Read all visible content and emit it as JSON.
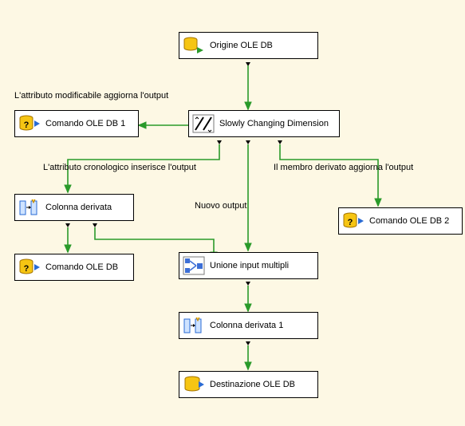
{
  "diagram": {
    "type": "ssis-data-flow",
    "background_color": "#fdf8e4",
    "nodes": {
      "source": {
        "label": "Origine OLE DB",
        "kind": "ole-db-source"
      },
      "scd": {
        "label": "Slowly Changing Dimension",
        "kind": "scd-transform"
      },
      "cmd1": {
        "label": "Comando OLE DB 1",
        "kind": "ole-db-command"
      },
      "cmd2": {
        "label": "Comando OLE DB 2",
        "kind": "ole-db-command"
      },
      "derived": {
        "label": "Colonna derivata",
        "kind": "derived-column"
      },
      "cmd": {
        "label": "Comando OLE DB",
        "kind": "ole-db-command"
      },
      "union": {
        "label": "Unione input multipli",
        "kind": "union-all"
      },
      "derived1": {
        "label": "Colonna derivata 1",
        "kind": "derived-column"
      },
      "dest": {
        "label": "Destinazione OLE DB",
        "kind": "ole-db-destination"
      }
    },
    "edge_labels": {
      "changing_attr": "L'attributo modificabile aggiorna l'output",
      "historical_attr": "L'attributo cronologico inserisce l'output",
      "inferred_member": "Il membro derivato aggiorna l'output",
      "new_output": "Nuovo output"
    },
    "edges": [
      {
        "from": "source",
        "to": "scd"
      },
      {
        "from": "scd",
        "to": "cmd1",
        "label": "changing_attr"
      },
      {
        "from": "scd",
        "to": "cmd2",
        "label": "inferred_member"
      },
      {
        "from": "scd",
        "to": "derived",
        "label": "historical_attr"
      },
      {
        "from": "scd",
        "to": "union",
        "label": "new_output"
      },
      {
        "from": "derived",
        "to": "cmd"
      },
      {
        "from": "derived",
        "to": "union"
      },
      {
        "from": "union",
        "to": "derived1"
      },
      {
        "from": "derived1",
        "to": "dest"
      }
    ]
  }
}
